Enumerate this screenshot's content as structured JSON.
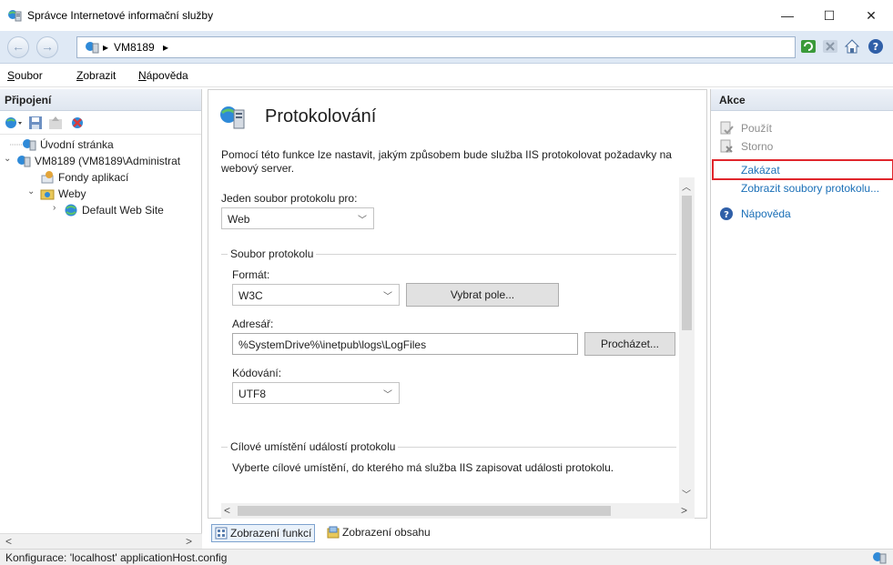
{
  "window": {
    "title": "Správce Internetové informační služby",
    "controls": {
      "minimize": "—",
      "maximize": "☐",
      "close": "✕"
    }
  },
  "address_bar": {
    "crumbs": [
      "VM8189"
    ],
    "separator": "▸"
  },
  "menu": {
    "items": [
      {
        "pre": "",
        "acc": "S",
        "post": "oubor"
      },
      {
        "pre": "",
        "acc": "Z",
        "post": "obrazit"
      },
      {
        "pre": "",
        "acc": "N",
        "post": "ápověda"
      }
    ]
  },
  "connections": {
    "header": "Připojení",
    "tree": [
      {
        "label": "Úvodní stránka",
        "icon": "server-icon"
      },
      {
        "label": "VM8189 (VM8189\\Administrat",
        "icon": "server-icon",
        "expander": "⌄"
      },
      {
        "label": "Fondy aplikací",
        "icon": "app-pool-icon"
      },
      {
        "label": "Weby",
        "icon": "sites-folder-icon",
        "expander": "⌄"
      },
      {
        "label": "Default Web Site",
        "icon": "globe-icon",
        "expander": "›"
      }
    ],
    "scroll_left": "<",
    "scroll_right": ">"
  },
  "feature": {
    "title": "Protokolování",
    "description": "Pomocí této funkce lze nastavit, jakým způsobem bude služba IIS protokolovat požadavky na webový server.",
    "one_log_label": "Jeden soubor protokolu pro:",
    "one_log_value": "Web",
    "log_file_group": "Soubor protokolu",
    "format_label": "Formát:",
    "format_value": "W3C",
    "select_fields_button": "Vybrat pole...",
    "directory_label": "Adresář:",
    "directory_value": "%SystemDrive%\\inetpub\\logs\\LogFiles",
    "browse_button": "Procházet...",
    "encoding_label": "Kódování:",
    "encoding_value": "UTF8",
    "event_dest_group": "Cílové umístění událostí protokolu",
    "event_dest_desc": "Vyberte cílové umístění, do kterého má služba IIS zapisovat události protokolu."
  },
  "view_tabs": {
    "features": "Zobrazení funkcí",
    "content": "Zobrazení obsahu"
  },
  "actions": {
    "header": "Akce",
    "items": [
      {
        "label": "Použít",
        "state": "disabled",
        "icon": "apply-icon"
      },
      {
        "label": "Storno",
        "state": "disabled",
        "icon": "cancel-icon"
      },
      {
        "label": "Zakázat",
        "state": "link",
        "icon": ""
      },
      {
        "label": "Zobrazit soubory protokolu...",
        "state": "link",
        "icon": ""
      },
      {
        "label": "Nápověda",
        "state": "link",
        "icon": "help-icon"
      }
    ]
  },
  "status_bar": {
    "text": "Konfigurace: 'localhost' applicationHost.config"
  },
  "colors": {
    "link": "#1a6fb7",
    "highlight": "#e0262c",
    "address_bar_bg": "#dfe9f5"
  }
}
